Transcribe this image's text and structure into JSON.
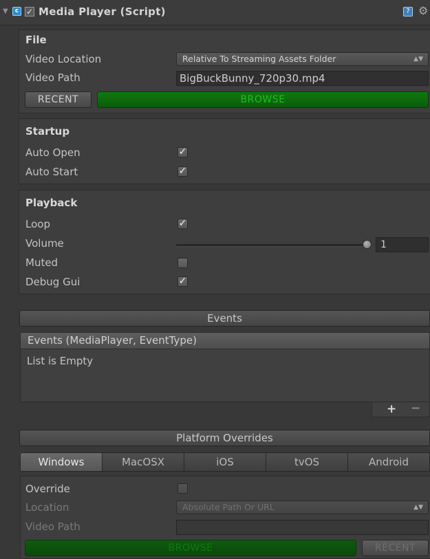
{
  "header": {
    "title": "Media Player (Script)",
    "enabled": true,
    "script_icon": "script-icon",
    "help_icon": "help-icon",
    "settings_icon": "gear-icon"
  },
  "file": {
    "heading": "File",
    "video_location_label": "Video Location",
    "video_location_value": "Relative To Streaming Assets Folder",
    "video_path_label": "Video Path",
    "video_path_value": "BigBuckBunny_720p30.mp4",
    "recent_label": "RECENT",
    "browse_label": "BROWSE"
  },
  "startup": {
    "heading": "Startup",
    "auto_open_label": "Auto Open",
    "auto_open": true,
    "auto_start_label": "Auto Start",
    "auto_start": true
  },
  "playback": {
    "heading": "Playback",
    "loop_label": "Loop",
    "loop": true,
    "volume_label": "Volume",
    "volume_value": "1",
    "muted_label": "Muted",
    "muted": false,
    "debug_gui_label": "Debug Gui",
    "debug_gui": true
  },
  "events": {
    "foldout_label": "Events",
    "list_header": "Events (MediaPlayer, EventType)",
    "empty_text": "List is Empty",
    "add_label": "+",
    "remove_label": "−"
  },
  "platform": {
    "foldout_label": "Platform Overrides",
    "tabs": [
      "Windows",
      "MacOSX",
      "iOS",
      "tvOS",
      "Android"
    ],
    "active_tab": "Windows",
    "override_label": "Override",
    "override": false,
    "location_label": "Location",
    "location_value": "Absolute Path Or URL",
    "video_path_label": "Video Path",
    "video_path_value": "",
    "browse_label": "BROWSE",
    "recent_label": "RECENT"
  },
  "colors": {
    "background": "#383838",
    "browse_green": "#0f7a0f",
    "browse_text": "#1fbf1f"
  }
}
